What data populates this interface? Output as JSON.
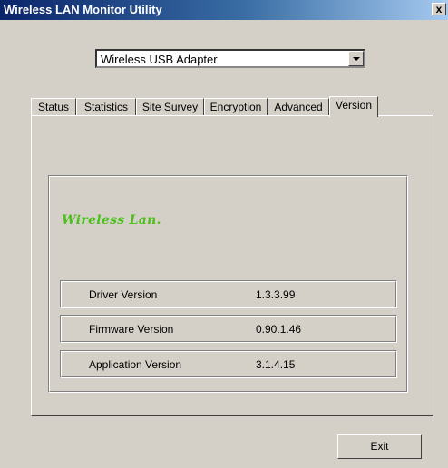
{
  "window": {
    "title": "Wireless LAN Monitor Utility",
    "close_label": "x"
  },
  "adapter": {
    "selected": "Wireless USB Adapter"
  },
  "tabs": [
    {
      "label": "Status"
    },
    {
      "label": "Statistics"
    },
    {
      "label": "Site Survey"
    },
    {
      "label": "Encryption"
    },
    {
      "label": "Advanced"
    },
    {
      "label": "Version"
    }
  ],
  "active_tab": "Version",
  "version": {
    "logo_text": "Wireless Lan.",
    "rows": [
      {
        "label": "Driver Version",
        "value": "1.3.3.99"
      },
      {
        "label": "Firmware Version",
        "value": "0.90.1.46"
      },
      {
        "label": "Application Version",
        "value": "3.1.4.15"
      }
    ]
  },
  "buttons": {
    "exit": "Exit"
  },
  "colors": {
    "title_bar_start": "#0a246a",
    "title_bar_end": "#a6caf0",
    "dialog_bg": "#d4d0c8",
    "logo_text": "#4bbf1c"
  }
}
